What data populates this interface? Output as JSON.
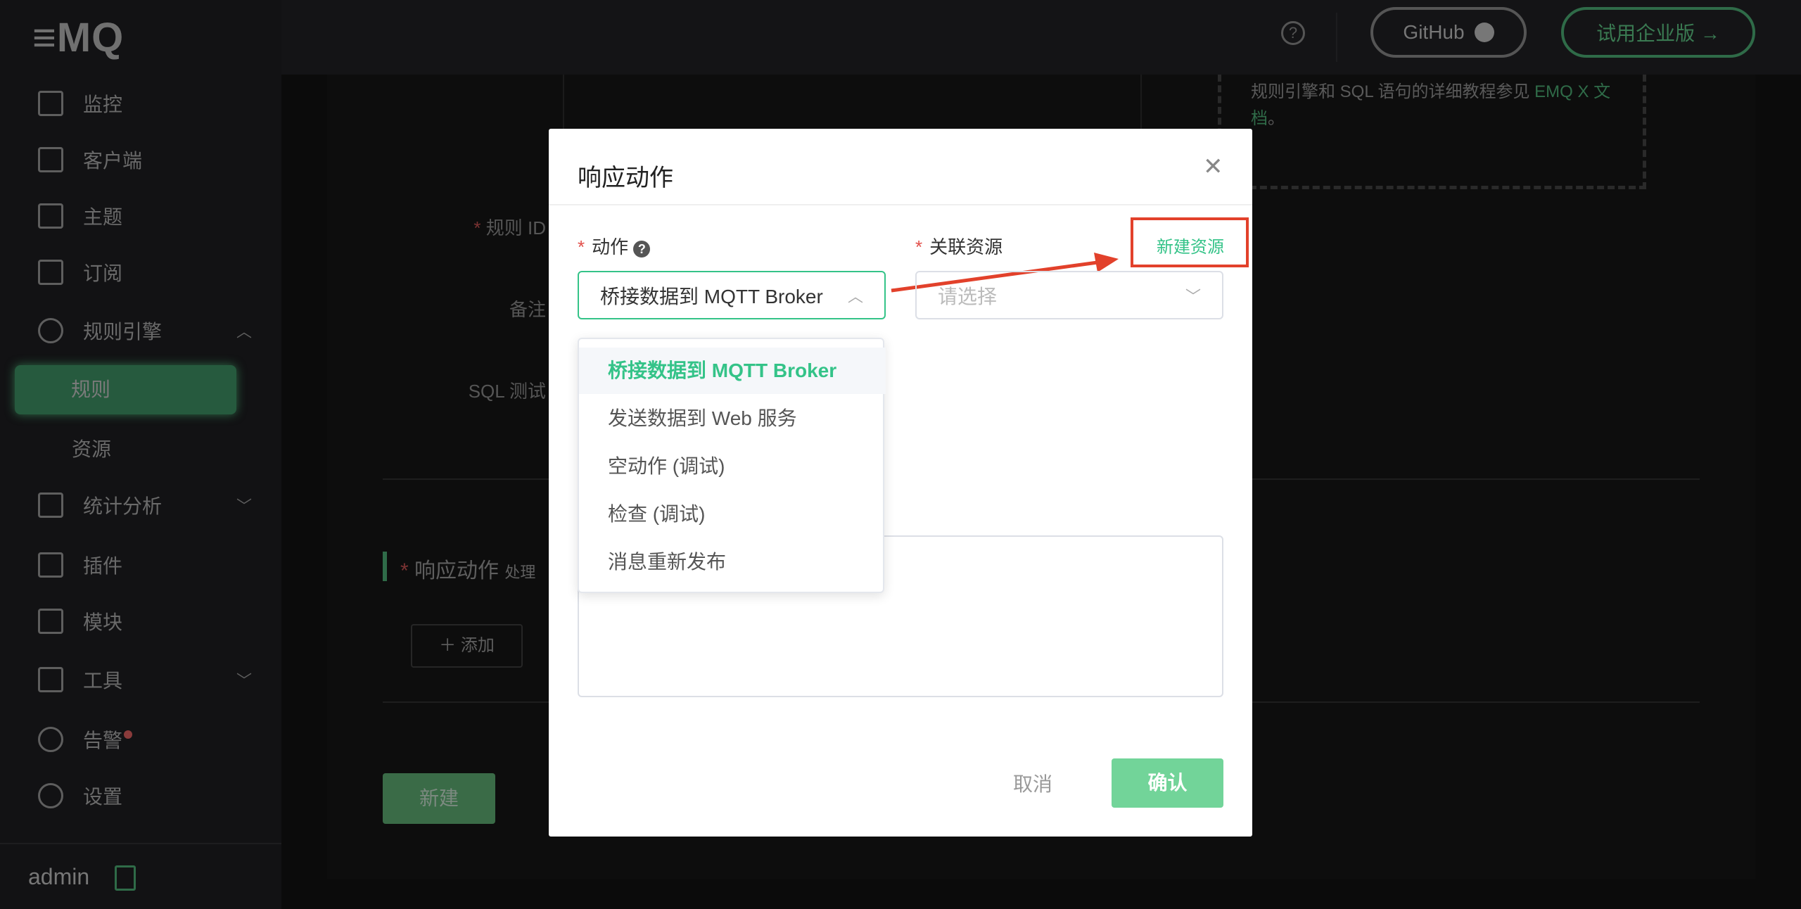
{
  "app": {
    "logo": "≡MQ"
  },
  "sidebar": {
    "items": [
      {
        "label": "监控",
        "icon": "monitor-icon"
      },
      {
        "label": "客户端",
        "icon": "clients-icon"
      },
      {
        "label": "主题",
        "icon": "topics-icon"
      },
      {
        "label": "订阅",
        "icon": "subscriptions-icon"
      },
      {
        "label": "规则引擎",
        "icon": "rule-engine-icon",
        "expanded": true
      },
      {
        "label": "统计分析",
        "icon": "analysis-icon"
      },
      {
        "label": "插件",
        "icon": "plugins-icon"
      },
      {
        "label": "模块",
        "icon": "modules-icon"
      },
      {
        "label": "工具",
        "icon": "tools-icon"
      },
      {
        "label": "告警",
        "icon": "alarm-icon",
        "badge": true
      },
      {
        "label": "设置",
        "icon": "settings-icon"
      }
    ],
    "sub_items": [
      {
        "label": "规则",
        "active": true
      },
      {
        "label": "资源"
      }
    ],
    "user": "admin"
  },
  "header": {
    "github": "GitHub",
    "enterprise": "试用企业版 →"
  },
  "form": {
    "rule_id_label": "规则 ID",
    "remark_label": "备注",
    "sql_test_label": "SQL 测试",
    "actions_label": "响应动作",
    "actions_hint": "处理",
    "add_label": "添加",
    "create_label": "新建",
    "tip_text": "规则引擎和 SQL 语句的详细教程参见 ",
    "tip_link": "EMQ X 文档",
    "tip_end": "。"
  },
  "dialog": {
    "title": "响应动作",
    "action_label": "动作",
    "resource_label": "关联资源",
    "new_resource": "新建资源",
    "action_value": "桥接数据到 MQTT Broker",
    "resource_placeholder": "请选择",
    "options": [
      "桥接数据到 MQTT Broker",
      "发送数据到 Web 服务",
      "空动作 (调试)",
      "检查 (调试)",
      "消息重新发布"
    ],
    "cancel": "取消",
    "confirm": "确认"
  },
  "colors": {
    "accent": "#34c388",
    "highlight": "#e2412b"
  }
}
